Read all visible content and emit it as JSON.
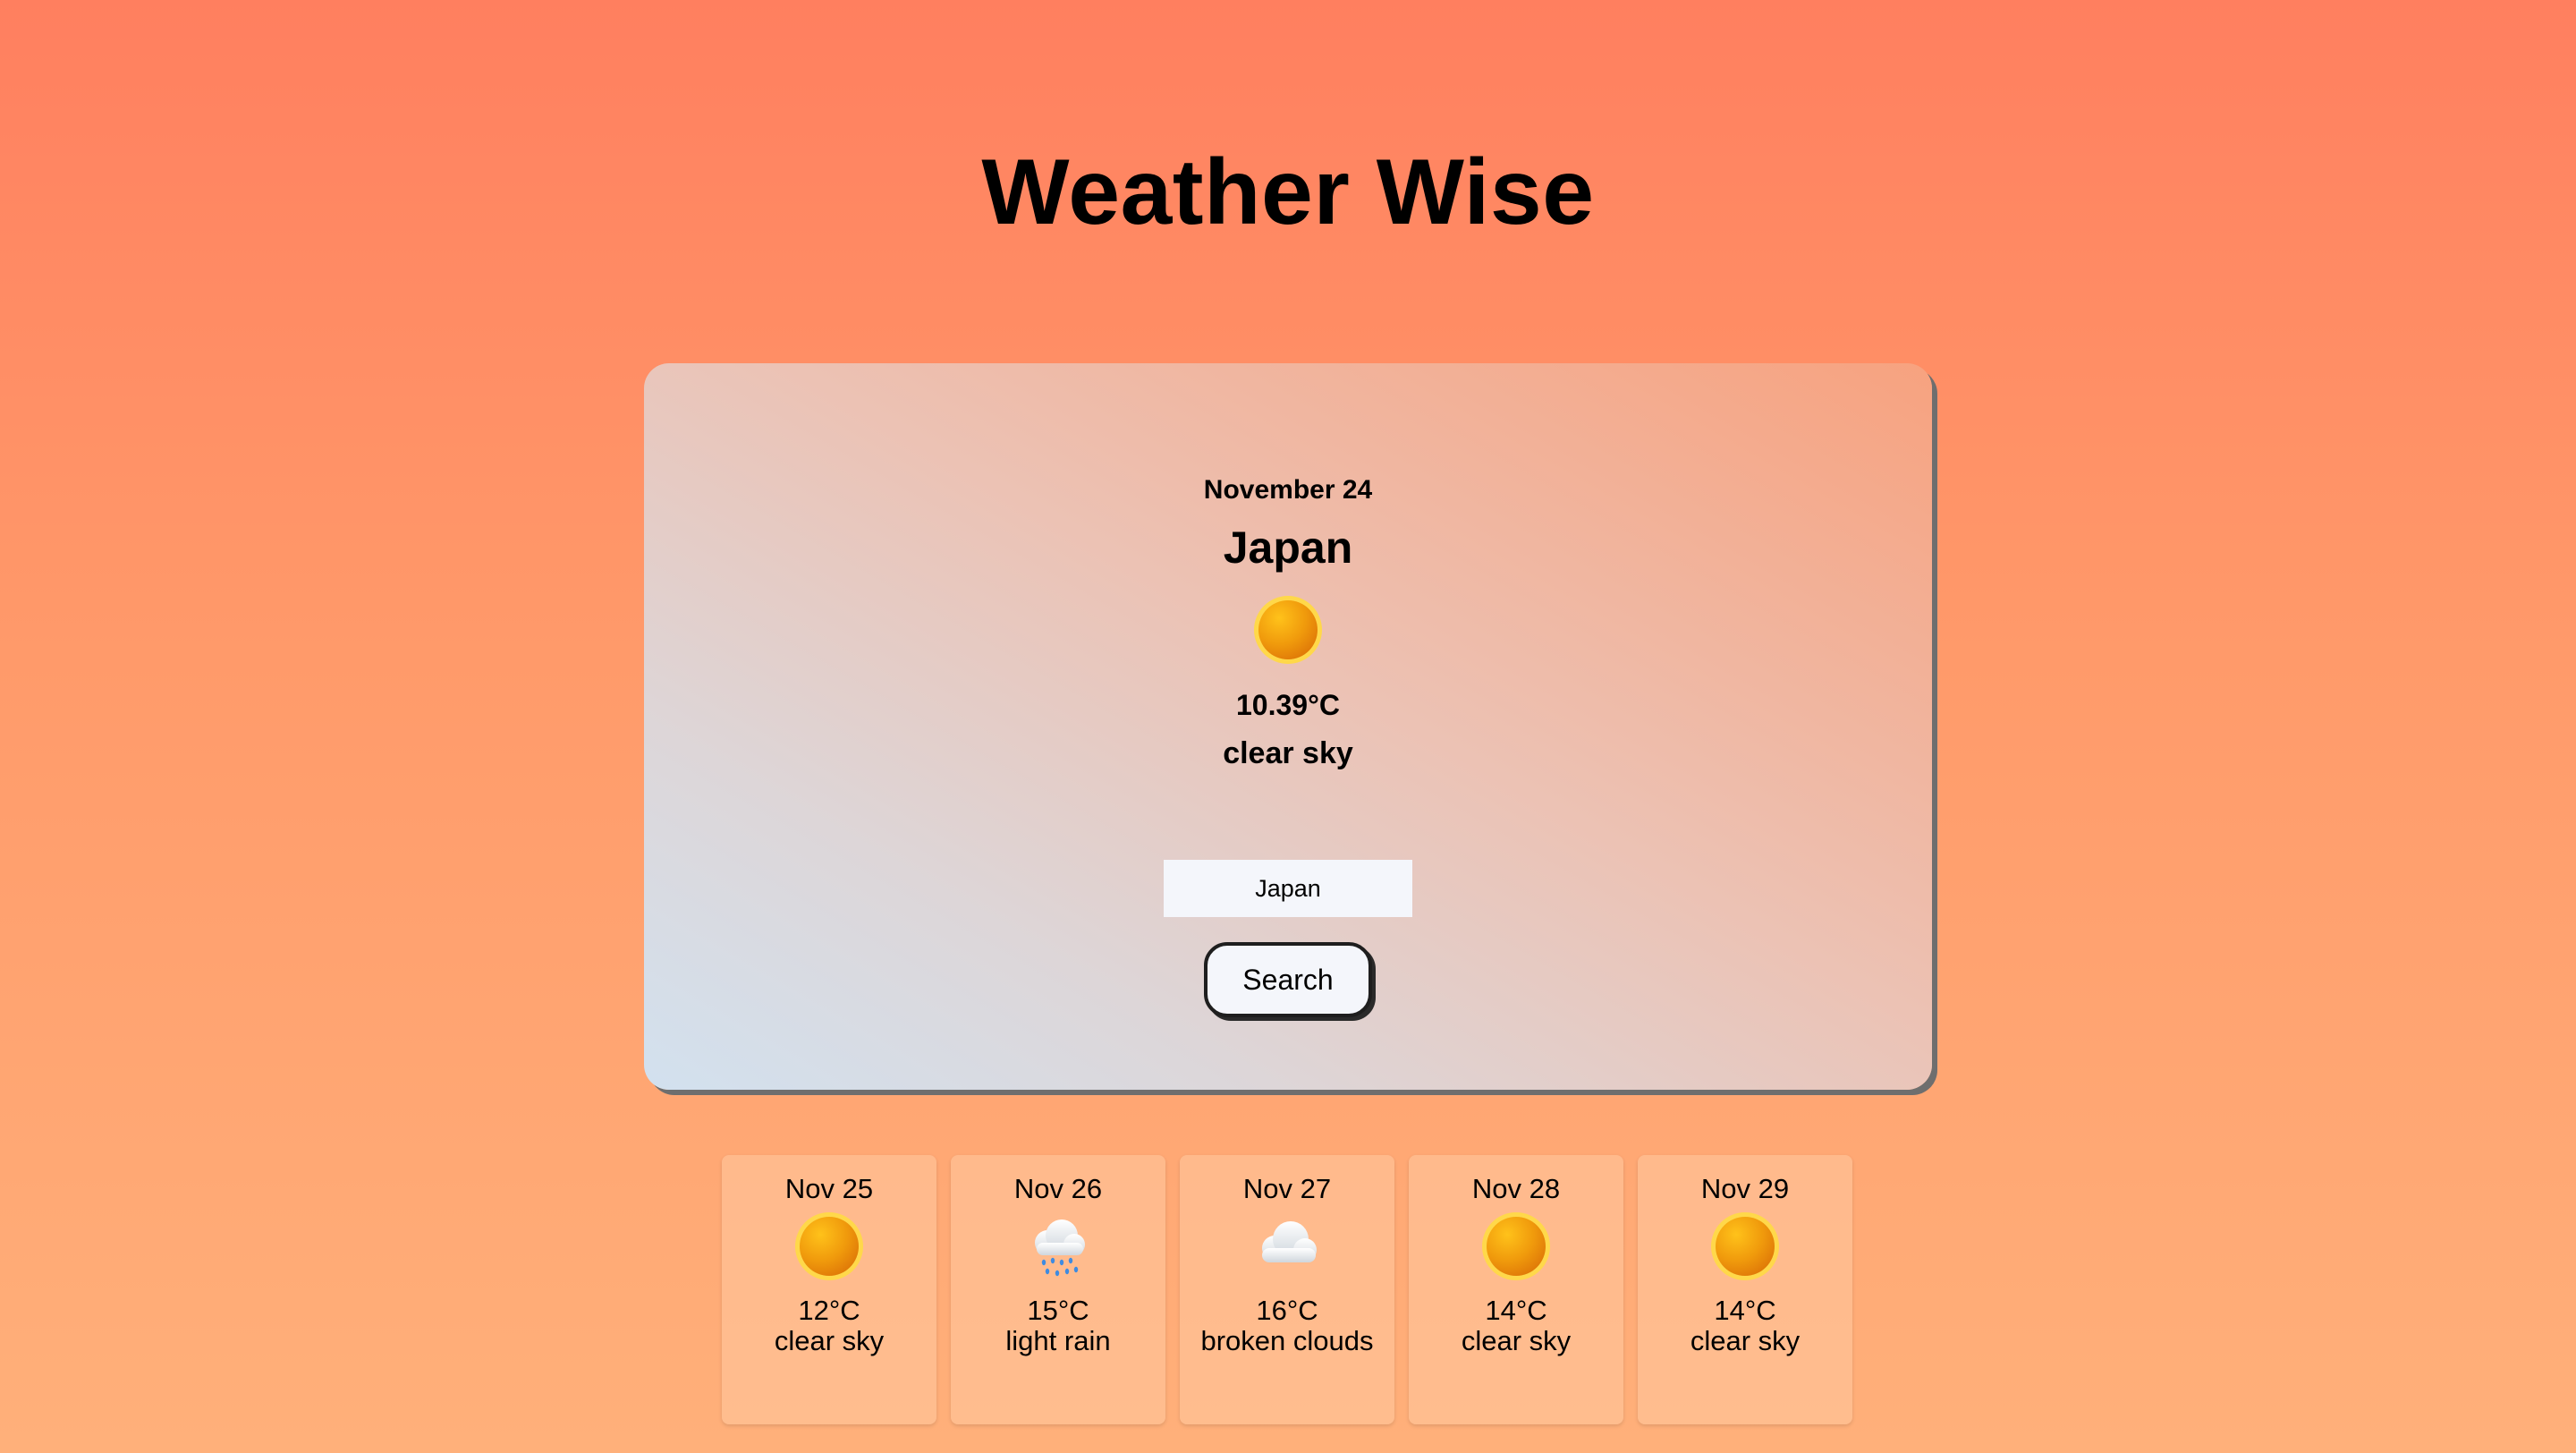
{
  "app": {
    "title": "Weather Wise"
  },
  "current": {
    "date": "November 24",
    "city": "Japan",
    "temperature": "10.39°C",
    "description": "clear sky",
    "icon": "sun-icon"
  },
  "search": {
    "input_value": "Japan",
    "button_label": "Search"
  },
  "forecast": [
    {
      "date": "Nov 25",
      "temperature": "12°C",
      "description": "clear sky",
      "icon": "sun-icon"
    },
    {
      "date": "Nov 26",
      "temperature": "15°C",
      "description": "light rain",
      "icon": "rain-cloud-icon"
    },
    {
      "date": "Nov 27",
      "temperature": "16°C",
      "description": "broken clouds",
      "icon": "cloud-icon"
    },
    {
      "date": "Nov 28",
      "temperature": "14°C",
      "description": "clear sky",
      "icon": "sun-icon"
    },
    {
      "date": "Nov 29",
      "temperature": "14°C",
      "description": "clear sky",
      "icon": "sun-icon"
    }
  ],
  "colors": {
    "background_top": "#ff7f5f",
    "background_bottom": "#ffb07a",
    "sun_fill": "#f39a10",
    "sun_ring": "#ffd23a"
  }
}
